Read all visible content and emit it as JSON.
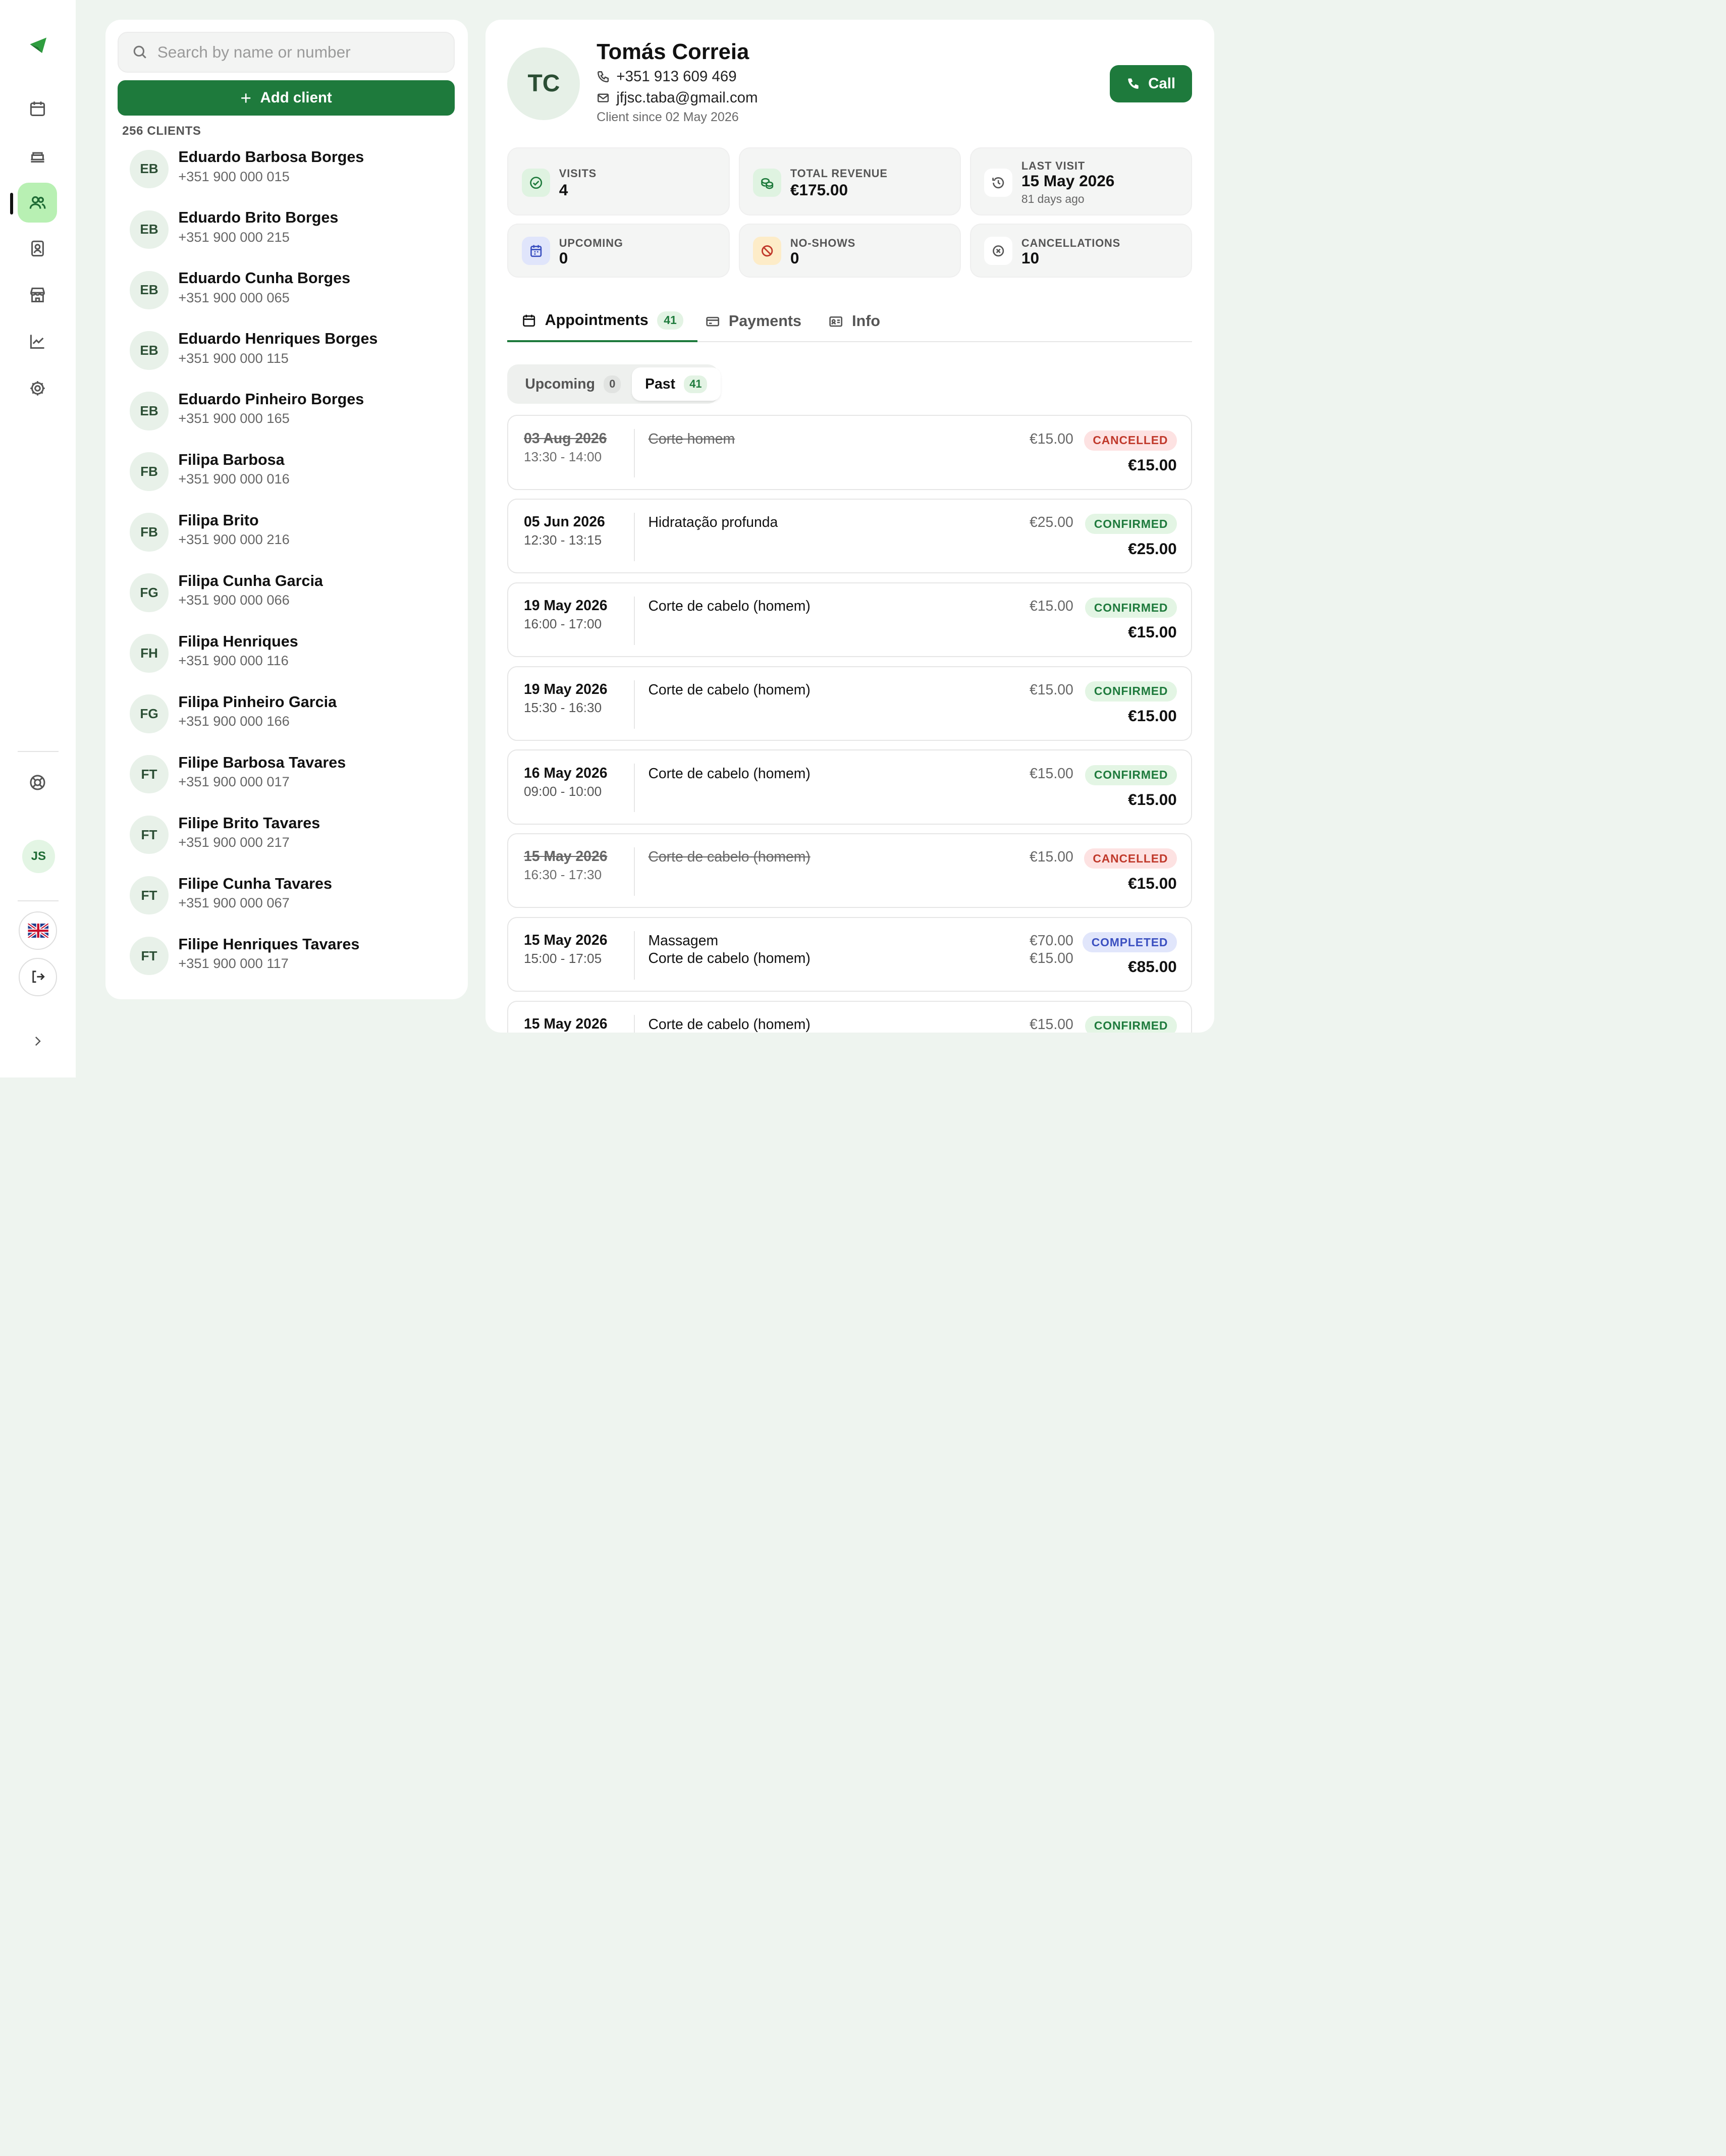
{
  "rail": {
    "nav": [
      {
        "name": "calendar-icon"
      },
      {
        "name": "services-icon"
      },
      {
        "name": "clients-icon",
        "active": true
      },
      {
        "name": "staff-icon"
      },
      {
        "name": "store-icon"
      },
      {
        "name": "reports-icon"
      },
      {
        "name": "settings-icon"
      }
    ],
    "avatar_initials": "JS"
  },
  "clients": {
    "search_placeholder": "Search by name or number",
    "add_label": "Add client",
    "count_label": "256 CLIENTS",
    "items": [
      {
        "initials": "EB",
        "name": "Eduardo Barbosa Borges",
        "phone": "+351 900 000 015"
      },
      {
        "initials": "EB",
        "name": "Eduardo Brito Borges",
        "phone": "+351 900 000 215"
      },
      {
        "initials": "EB",
        "name": "Eduardo Cunha Borges",
        "phone": "+351 900 000 065"
      },
      {
        "initials": "EB",
        "name": "Eduardo Henriques Borges",
        "phone": "+351 900 000 115"
      },
      {
        "initials": "EB",
        "name": "Eduardo Pinheiro Borges",
        "phone": "+351 900 000 165"
      },
      {
        "initials": "FB",
        "name": "Filipa Barbosa",
        "phone": "+351 900 000 016"
      },
      {
        "initials": "FB",
        "name": "Filipa Brito",
        "phone": "+351 900 000 216"
      },
      {
        "initials": "FG",
        "name": "Filipa Cunha Garcia",
        "phone": "+351 900 000 066"
      },
      {
        "initials": "FH",
        "name": "Filipa Henriques",
        "phone": "+351 900 000 116"
      },
      {
        "initials": "FG",
        "name": "Filipa Pinheiro Garcia",
        "phone": "+351 900 000 166"
      },
      {
        "initials": "FT",
        "name": "Filipe Barbosa Tavares",
        "phone": "+351 900 000 017"
      },
      {
        "initials": "FT",
        "name": "Filipe Brito Tavares",
        "phone": "+351 900 000 217"
      },
      {
        "initials": "FT",
        "name": "Filipe Cunha Tavares",
        "phone": "+351 900 000 067"
      },
      {
        "initials": "FT",
        "name": "Filipe Henriques Tavares",
        "phone": "+351 900 000 117"
      }
    ]
  },
  "detail": {
    "initials": "TC",
    "name": "Tomás Correia",
    "phone": "+351 913 609 469",
    "email": "jfjsc.taba@gmail.com",
    "since": "Client since 02 May 2026",
    "call_label": "Call",
    "stats": {
      "visits": {
        "label": "VISITS",
        "value": "4"
      },
      "revenue": {
        "label": "TOTAL REVENUE",
        "value": "€175.00"
      },
      "last_visit": {
        "label": "LAST VISIT",
        "value": "15 May 2026",
        "sub": "81 days ago"
      },
      "upcoming": {
        "label": "UPCOMING",
        "value": "0"
      },
      "no_shows": {
        "label": "NO-SHOWS",
        "value": "0"
      },
      "cancellations": {
        "label": "CANCELLATIONS",
        "value": "10"
      }
    },
    "tabs": {
      "appointments": {
        "label": "Appointments",
        "count": "41"
      },
      "payments": {
        "label": "Payments"
      },
      "info": {
        "label": "Info"
      }
    },
    "segments": {
      "upcoming": {
        "label": "Upcoming",
        "count": "0"
      },
      "past": {
        "label": "Past",
        "count": "41"
      }
    },
    "appointments": [
      {
        "date": "03 Aug 2026",
        "time": "13:30 - 14:00",
        "services": [
          "Corte homem"
        ],
        "prices": [
          "€15.00"
        ],
        "status": "CANCELLED",
        "status_key": "cancelled",
        "total": "€15.00"
      },
      {
        "date": "05 Jun 2026",
        "time": "12:30 - 13:15",
        "services": [
          "Hidratação profunda"
        ],
        "prices": [
          "€25.00"
        ],
        "status": "CONFIRMED",
        "status_key": "confirmed",
        "total": "€25.00"
      },
      {
        "date": "19 May 2026",
        "time": "16:00 - 17:00",
        "services": [
          "Corte de cabelo (homem)"
        ],
        "prices": [
          "€15.00"
        ],
        "status": "CONFIRMED",
        "status_key": "confirmed",
        "total": "€15.00"
      },
      {
        "date": "19 May 2026",
        "time": "15:30 - 16:30",
        "services": [
          "Corte de cabelo (homem)"
        ],
        "prices": [
          "€15.00"
        ],
        "status": "CONFIRMED",
        "status_key": "confirmed",
        "total": "€15.00"
      },
      {
        "date": "16 May 2026",
        "time": "09:00 - 10:00",
        "services": [
          "Corte de cabelo (homem)"
        ],
        "prices": [
          "€15.00"
        ],
        "status": "CONFIRMED",
        "status_key": "confirmed",
        "total": "€15.00"
      },
      {
        "date": "15 May 2026",
        "time": "16:30 - 17:30",
        "services": [
          "Corte de cabelo (homem)"
        ],
        "prices": [
          "€15.00"
        ],
        "status": "CANCELLED",
        "status_key": "cancelled",
        "total": "€15.00"
      },
      {
        "date": "15 May 2026",
        "time": "15:00 - 17:05",
        "services": [
          "Massagem",
          "Corte de cabelo (homem)"
        ],
        "prices": [
          "€70.00",
          "€15.00"
        ],
        "status": "COMPLETED",
        "status_key": "completed",
        "total": "€85.00"
      },
      {
        "date": "15 May 2026",
        "time": "",
        "services": [
          "Corte de cabelo (homem)"
        ],
        "prices": [
          "€15.00"
        ],
        "status": "CONFIRMED",
        "status_key": "confirmed",
        "total": ""
      }
    ]
  }
}
